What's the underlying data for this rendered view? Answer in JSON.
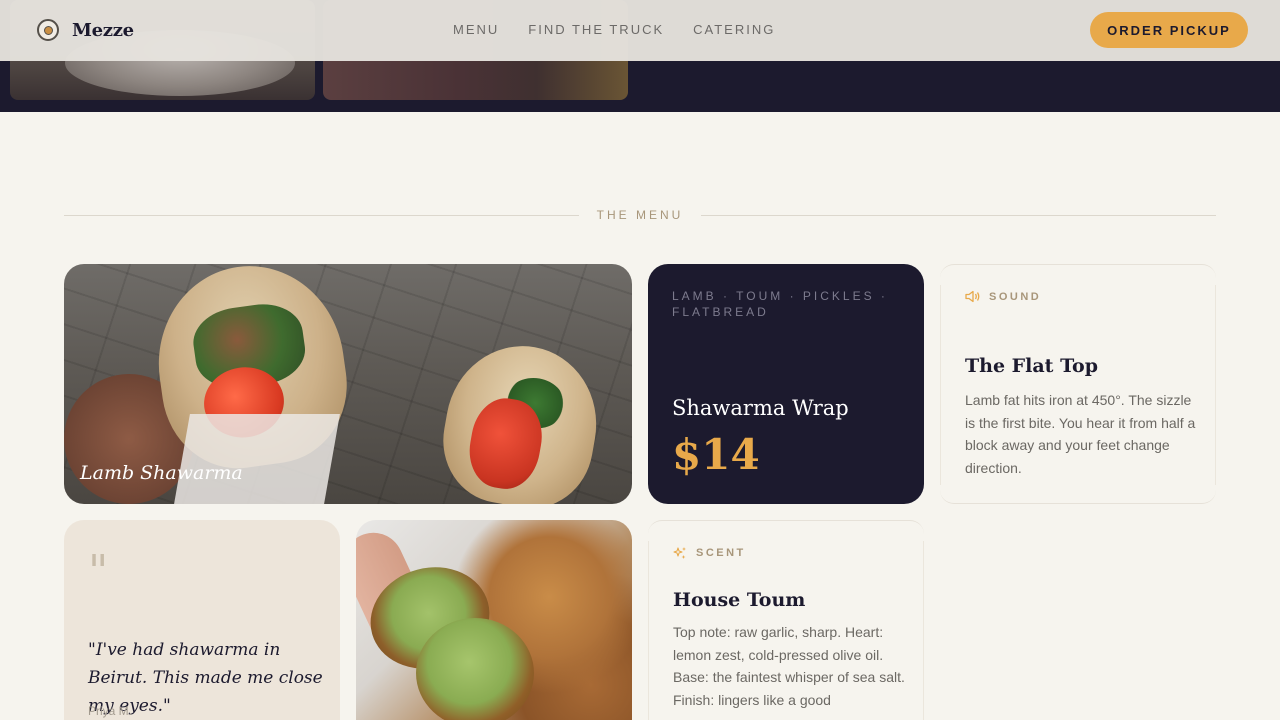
{
  "header": {
    "brand": "Mezze",
    "nav": [
      "MENU",
      "FIND THE TRUCK",
      "CATERING"
    ],
    "cta": "ORDER PICKUP"
  },
  "section": {
    "label": "THE MENU"
  },
  "feature_photo": {
    "caption": "Lamb Shawarma"
  },
  "price_card": {
    "tags": "LAMB · TOUM · PICKLES · FLATBREAD",
    "name": "Shawarma Wrap",
    "price": "$14"
  },
  "sound_card": {
    "label": "SOUND",
    "title": "The Flat Top",
    "body": "Lamb fat hits iron at 450°. The sizzle is the first bite. You hear it from half a block away and your feet change direction."
  },
  "scent_card": {
    "label": "SCENT",
    "title": "House Toum",
    "body": "Top note: raw garlic, sharp. Heart: lemon zest, cold-pressed olive oil. Base: the faintest whisper of sea salt. Finish: lingers like a good"
  },
  "quote_card": {
    "mark": "\"",
    "text": "\"I've had shawarma in Beirut. This made me close my eyes.\"",
    "author": "Priya M."
  },
  "colors": {
    "navy": "#1c1a2e",
    "accent": "#e8a94a",
    "cream": "#f6f4ee"
  }
}
